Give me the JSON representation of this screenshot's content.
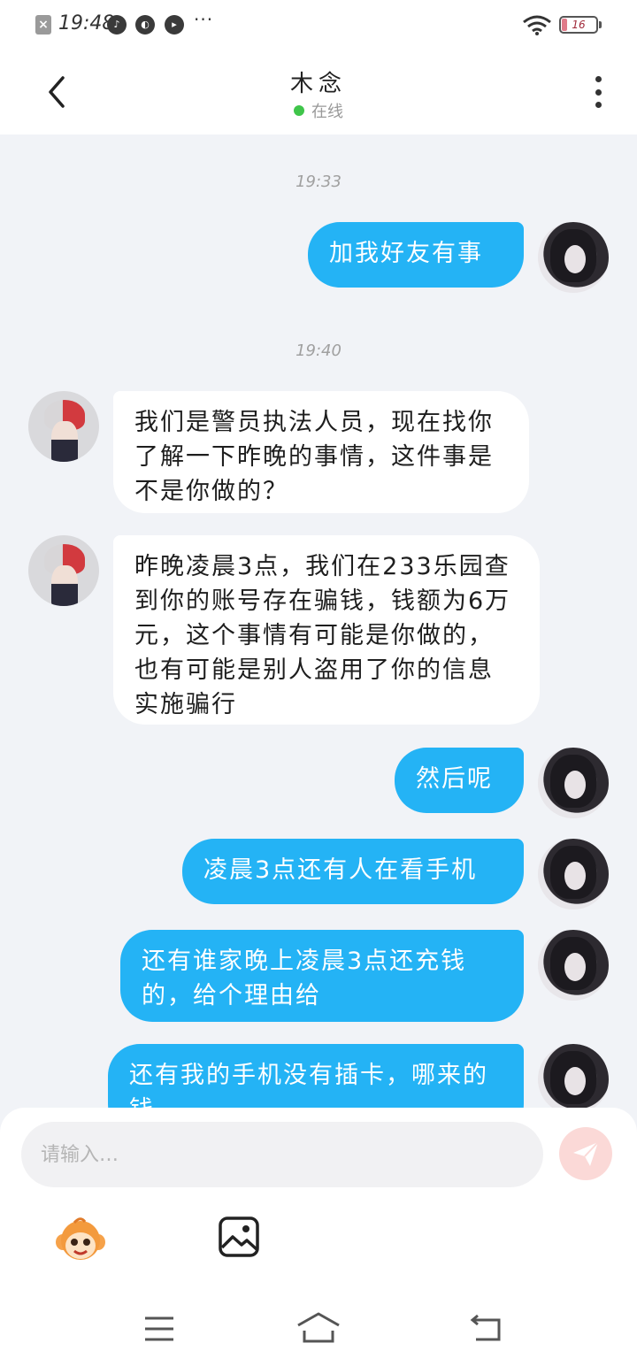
{
  "status_bar": {
    "time": "19:48",
    "more": "···",
    "battery_level": "16",
    "battery_fraction": 0.16
  },
  "header": {
    "title": "木念",
    "status": "在线"
  },
  "chat": {
    "messages": [
      {
        "type": "timestamp",
        "text": "19:33"
      },
      {
        "type": "outgoing",
        "text": "加我好友有事"
      },
      {
        "type": "timestamp",
        "text": "19:40"
      },
      {
        "type": "incoming",
        "text": "我们是警员执法人员，现在找你了解一下昨晚的事情，这件事是不是你做的？"
      },
      {
        "type": "incoming",
        "text": "昨晚凌晨3点，我们在233乐园查到你的账号存在骗钱，钱额为6万元，这个事情有可能是你做的，也有可能是别人盗用了你的信息实施骗行"
      },
      {
        "type": "outgoing",
        "text": "然后呢"
      },
      {
        "type": "outgoing",
        "text": "凌晨3点还有人在看手机"
      },
      {
        "type": "outgoing",
        "text": "还有谁家晚上凌晨3点还充钱的，给个理由给"
      },
      {
        "type": "outgoing",
        "text": "还有我的手机没有插卡，哪来的钱"
      }
    ]
  },
  "input": {
    "placeholder": "请输入…",
    "value": ""
  },
  "colors": {
    "outgoing_bubble": "#24b3f5",
    "incoming_bubble": "#ffffff",
    "online": "#3fc54a",
    "send_button": "#fbd9d7",
    "background": "#f1f3f7"
  },
  "icons": {
    "back": "chevron-left-icon",
    "more": "more-vertical-icon",
    "send": "send-icon",
    "emoji": "emoji-monkey-icon",
    "image": "image-icon",
    "nav_menu": "menu-icon",
    "nav_home": "home-icon",
    "nav_back": "back-arrow-icon"
  }
}
